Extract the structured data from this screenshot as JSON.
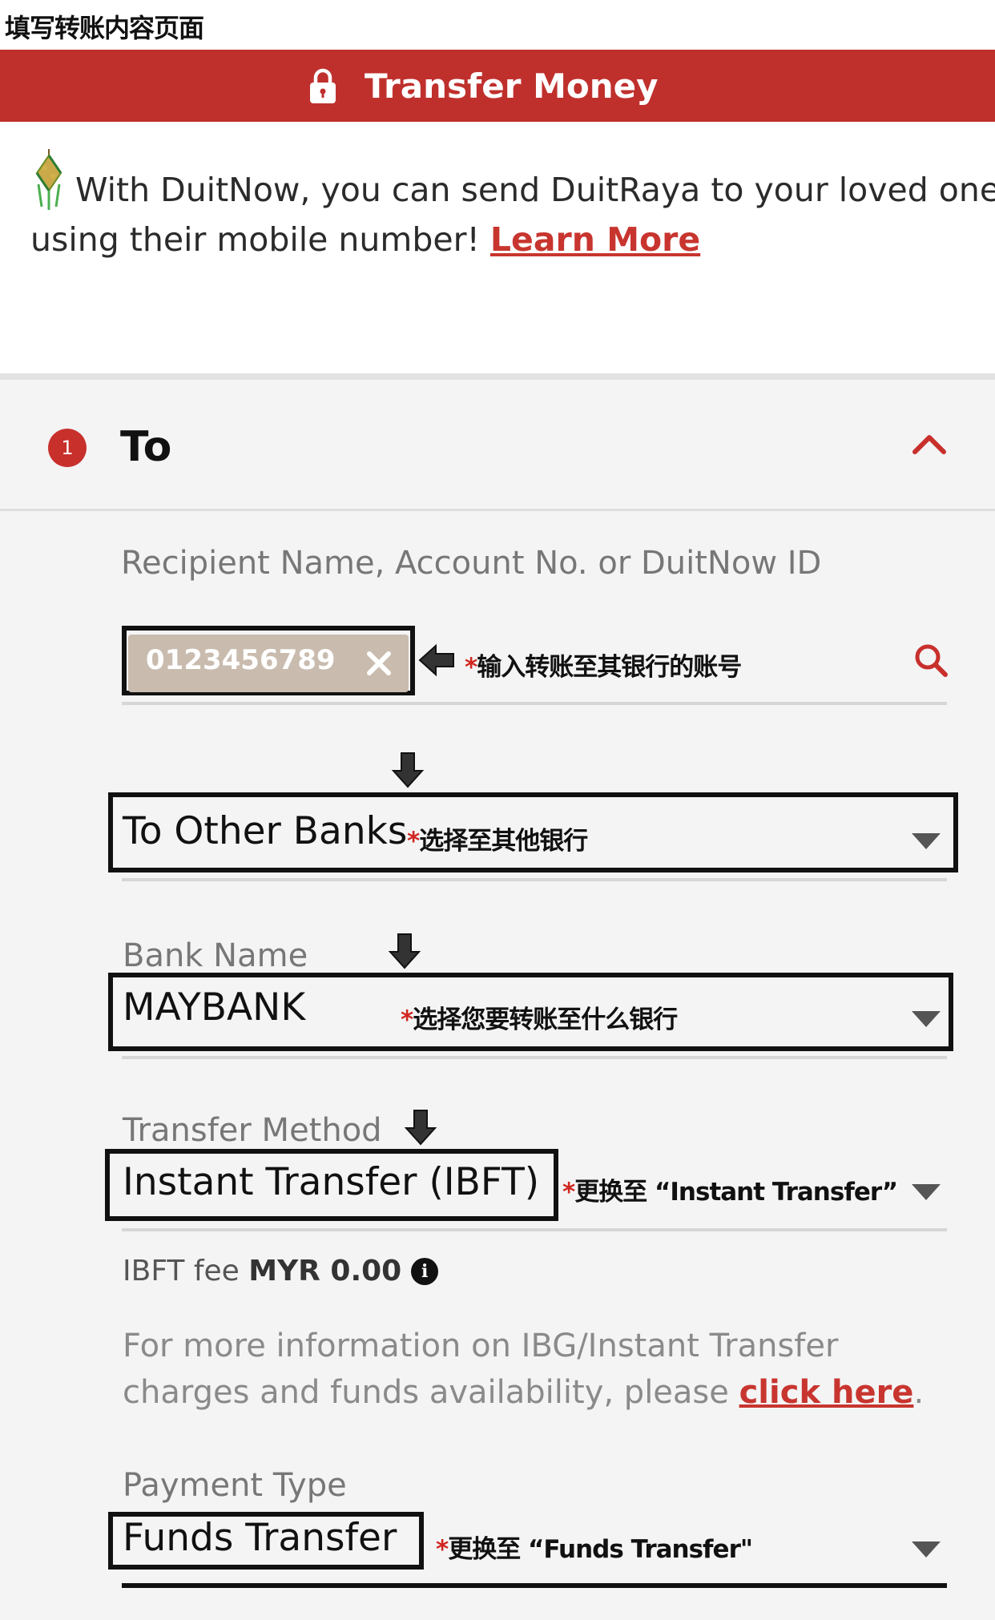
{
  "caption": "填写转账内容页面",
  "header": {
    "title": "Transfer Money",
    "icon": "lock-icon"
  },
  "promo": {
    "line1": "With DuitNow, you can send DuitRaya to your loved ones",
    "line2": "using their mobile number! ",
    "link": "Learn More"
  },
  "section": {
    "step": "1",
    "title": "To"
  },
  "recipient": {
    "label": "Recipient Name, Account No. or DuitNow ID",
    "value": "0123456789",
    "note_star": "*",
    "note": "输入转账至其银行的账号"
  },
  "transfer_type": {
    "value": "To Other Banks",
    "note_star": "*",
    "note": "选择至其他银行"
  },
  "bank": {
    "label": "Bank Name",
    "value": "MAYBANK",
    "note_star": "*",
    "note": "选择您要转账至什么银行"
  },
  "method": {
    "label": "Transfer Method",
    "value": "Instant Transfer (IBFT)",
    "note_star": "*",
    "note": "更换至 “Instant Transfer”"
  },
  "fee": {
    "label": "IBFT fee ",
    "amount": "MYR 0.00"
  },
  "info": {
    "line1": "For more information on IBG/Instant Transfer",
    "line2": "charges and funds availability, please ",
    "link": "click here",
    "end": "."
  },
  "payment": {
    "label": "Payment Type",
    "value": "Funds Transfer",
    "note_star": "*",
    "note": "更换至 “Funds Transfer\""
  },
  "colors": {
    "brand": "#bf302d",
    "link": "#c8352f",
    "chip": "#c9bcaf"
  }
}
